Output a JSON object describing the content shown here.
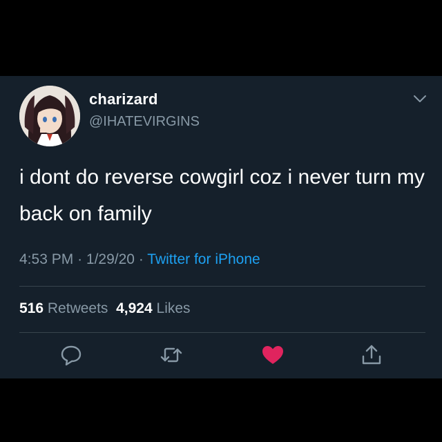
{
  "tweet": {
    "author": {
      "display_name": "charizard",
      "handle": "@IHATEVIRGINS"
    },
    "text": "i dont do reverse cowgirl coz i never turn my back on family",
    "time": "4:53 PM",
    "separator": "·",
    "date": "1/29/20",
    "source": "Twitter for iPhone",
    "stats": {
      "retweets": "516",
      "retweets_label": "Retweets",
      "likes": "4,924",
      "likes_label": "Likes"
    },
    "liked": true
  },
  "colors": {
    "background": "#15202b",
    "text_primary": "#ffffff",
    "text_secondary": "#8899a6",
    "link": "#1da1f2",
    "like": "#e0245e",
    "divider": "#38444d"
  },
  "icons": {
    "menu": "chevron-down-icon",
    "reply": "reply-icon",
    "retweet": "retweet-icon",
    "like": "heart-icon",
    "share": "share-icon"
  }
}
